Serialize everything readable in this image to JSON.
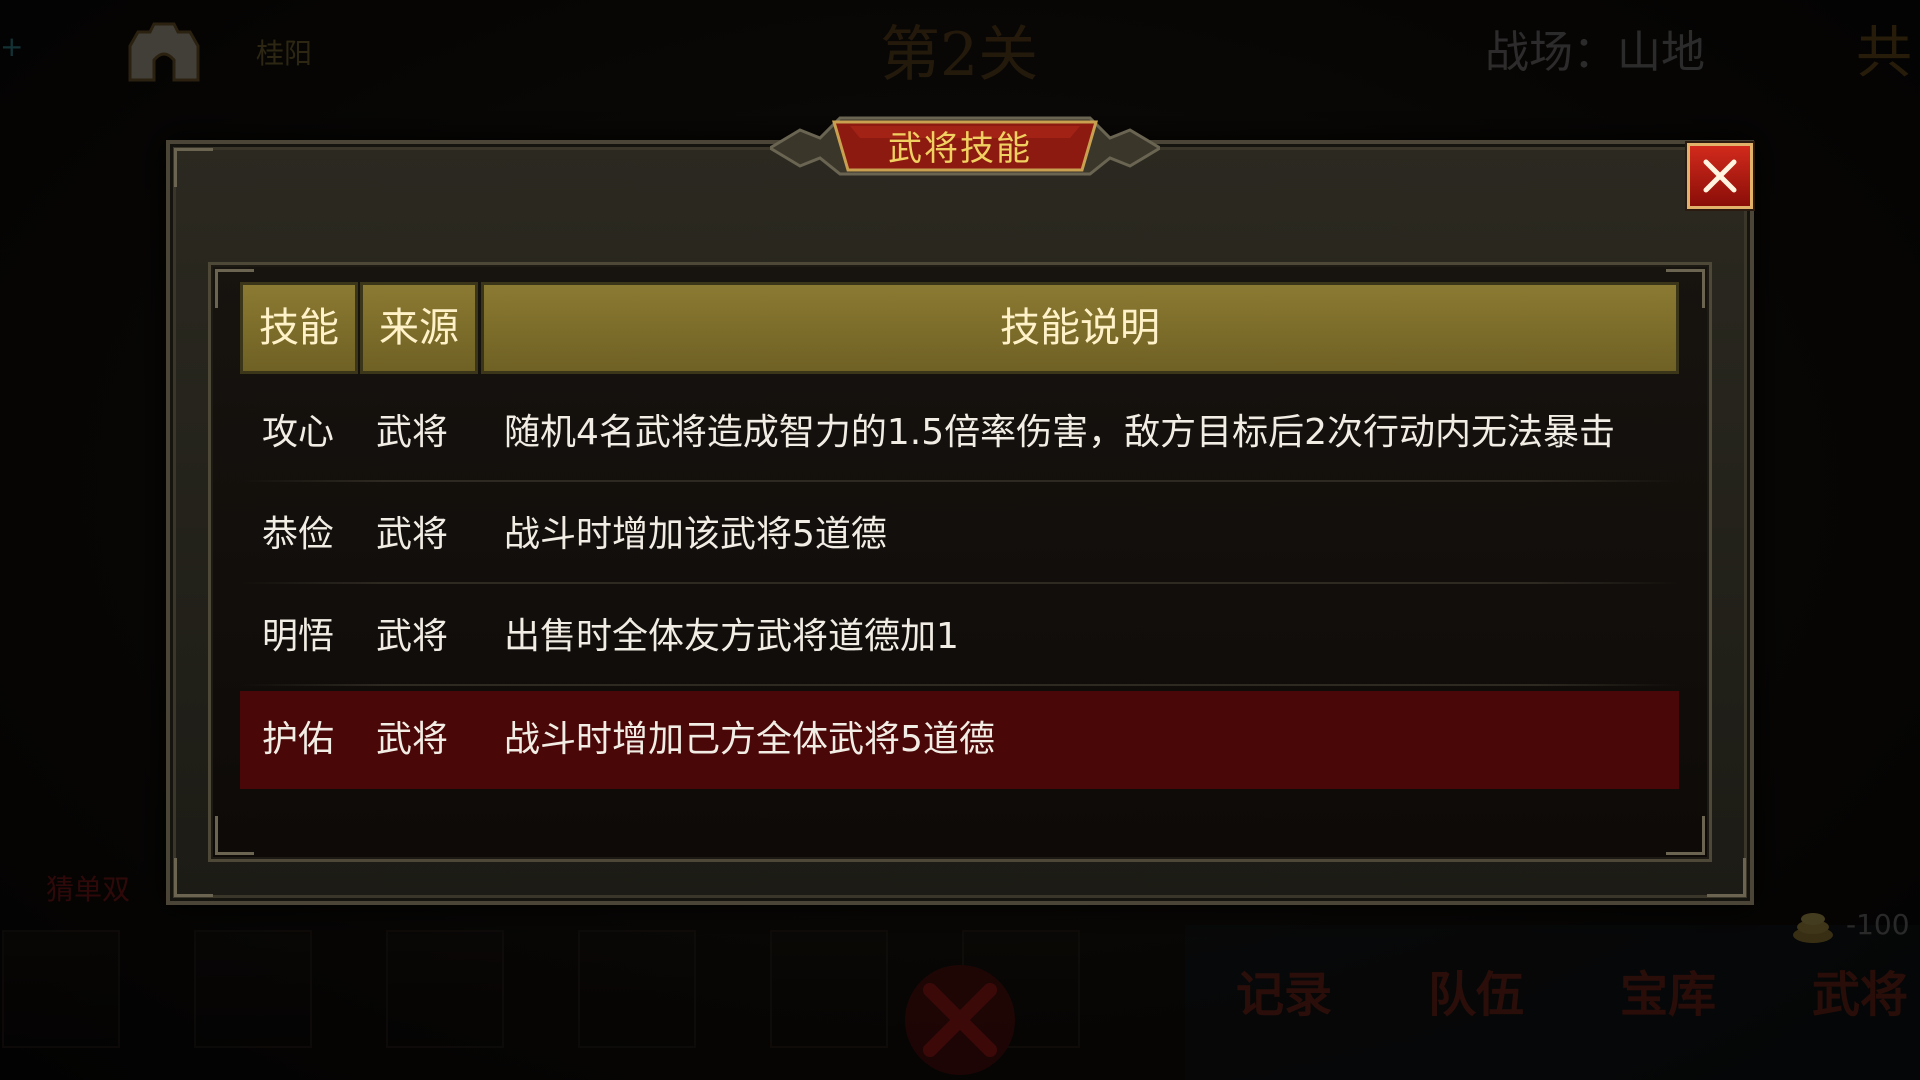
{
  "hud": {
    "city_name": "桂阳",
    "stage": "第2关",
    "battlefield": "战场：山地",
    "top_right_char": "共",
    "guess_label": "猜单双",
    "coin_value": "-100",
    "nav": [
      "记录",
      "队伍",
      "宝库",
      "武将"
    ]
  },
  "dialog": {
    "title": "武将技能",
    "columns": {
      "skill": "技能",
      "source": "来源",
      "description": "技能说明"
    },
    "rows": [
      {
        "skill": "攻心",
        "source": "武将",
        "description": "随机4名武将造成智力的1.5倍率伤害，敌方目标后2次行动内无法暴击",
        "selected": false
      },
      {
        "skill": "恭俭",
        "source": "武将",
        "description": "战斗时增加该武将5道德",
        "selected": false
      },
      {
        "skill": "明悟",
        "source": "武将",
        "description": "出售时全体友方武将道德加1",
        "selected": false
      },
      {
        "skill": "护佑",
        "source": "武将",
        "description": "战斗时增加己方全体武将5道德",
        "selected": true
      }
    ]
  },
  "colors": {
    "header_bg": "#7f6f2c",
    "selected_row": "#4a0708",
    "title_text": "#f0d060",
    "close_button": "#c0231a"
  }
}
